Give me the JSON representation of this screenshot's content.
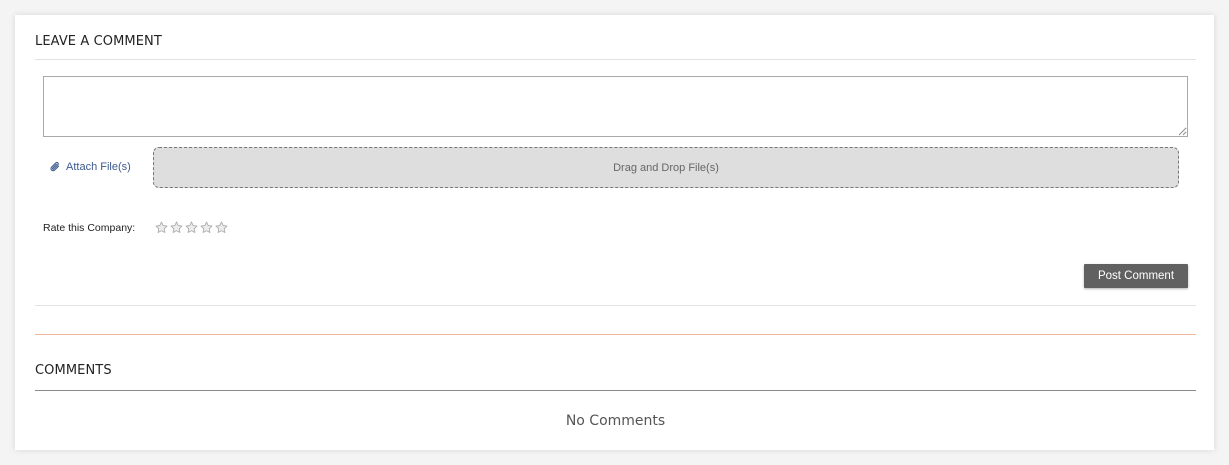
{
  "leave_comment": {
    "title": "LEAVE A COMMENT",
    "textarea_value": "",
    "attach_label": "Attach File(s)",
    "dropzone_label": "Drag and Drop File(s)",
    "rate_label": "Rate this Company:",
    "rating": {
      "value": 0,
      "max": 5
    },
    "post_button_label": "Post Comment"
  },
  "comments": {
    "title": "COMMENTS",
    "empty_text": "No Comments"
  },
  "icons": {
    "attach": "paperclip-icon",
    "star": "star-outline-icon"
  },
  "colors": {
    "link": "#3d5a8f",
    "button_bg": "#616161",
    "accent_divider": "#f2b79a",
    "dropzone_bg": "#dedede"
  }
}
